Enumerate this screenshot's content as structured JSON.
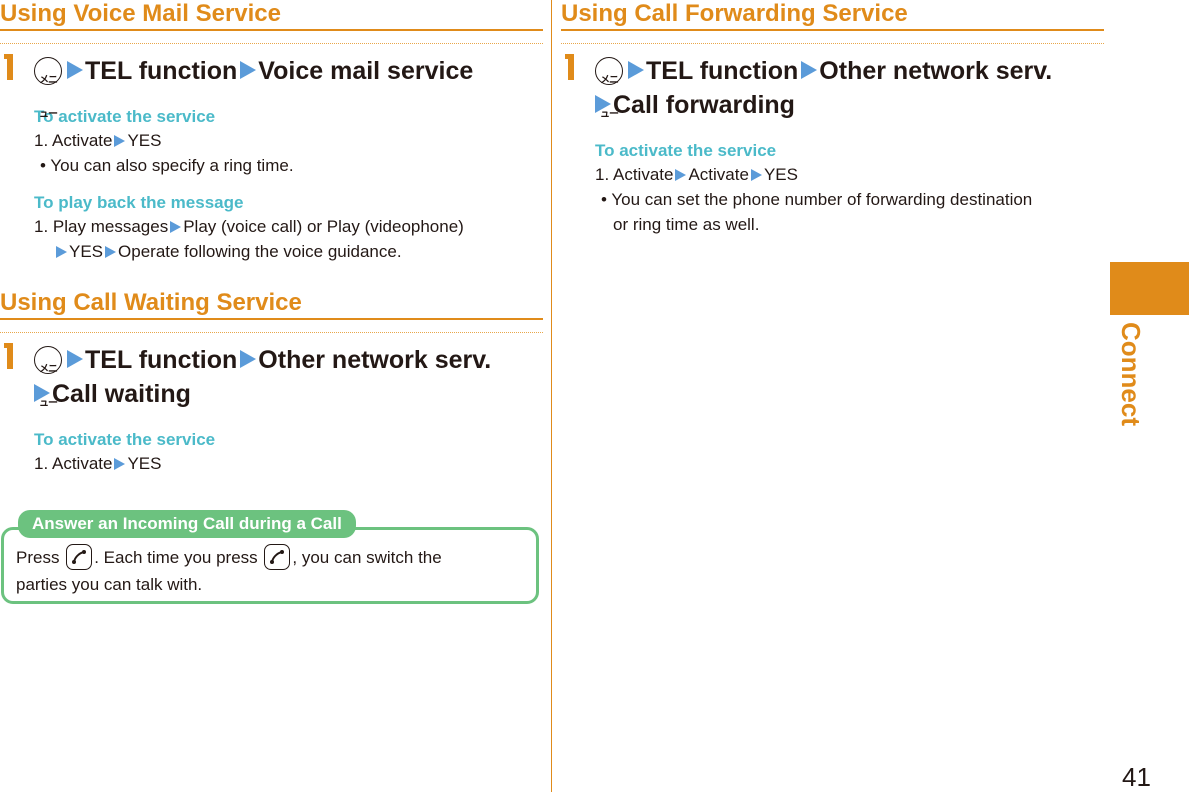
{
  "left_column": {
    "voice_mail": {
      "title": "Using Voice Mail Service",
      "step_number": "1",
      "menu_key_label": "メニュー",
      "step_path": [
        "TEL function",
        "Voice mail service"
      ],
      "activate": {
        "heading": "To activate the service",
        "steps": [
          {
            "num": "1.",
            "items": [
              "Activate",
              "YES"
            ]
          }
        ],
        "bullet": "You can also specify a ring time."
      },
      "playback": {
        "heading": "To play back the message",
        "line1_num": "1.",
        "line1_items": [
          "Play messages",
          "Play (voice call) or Play (videophone)"
        ],
        "line2_items": [
          "YES",
          "Operate following the voice guidance."
        ]
      }
    },
    "call_waiting": {
      "title": "Using Call Waiting Service",
      "step_number": "1",
      "menu_key_label": "メニュー",
      "step_path": [
        "TEL function",
        "Other network serv.",
        "Call waiting"
      ],
      "activate": {
        "heading": "To activate the service",
        "steps": [
          {
            "num": "1.",
            "items": [
              "Activate",
              "YES"
            ]
          }
        ]
      }
    },
    "note": {
      "tab_label": "Answer an Incoming Call during a Call",
      "text_part1": "Press",
      "text_part2": ". Each time you press",
      "text_part3": ", you can switch the",
      "text_part4": "parties you can talk with.",
      "key_icon": "phone-send-key"
    }
  },
  "right_column": {
    "call_forwarding": {
      "title": "Using Call Forwarding Service",
      "step_number": "1",
      "menu_key_label": "メニュー",
      "step_path": [
        "TEL function",
        "Other network serv.",
        "Call forwarding"
      ],
      "activate": {
        "heading": "To activate the service",
        "steps": [
          {
            "num": "1.",
            "items": [
              "Activate",
              "Activate",
              "YES"
            ]
          }
        ],
        "bullet_line1": "You can set the phone number of forwarding destination",
        "bullet_line2": "or ring time as well."
      }
    }
  },
  "side_tab": {
    "label": "Connect"
  },
  "page_number": "41",
  "colors": {
    "accent": "#e08b1a",
    "subheading": "#4bbac9",
    "arrow": "#5b9bd9",
    "note": "#6cc27f"
  }
}
